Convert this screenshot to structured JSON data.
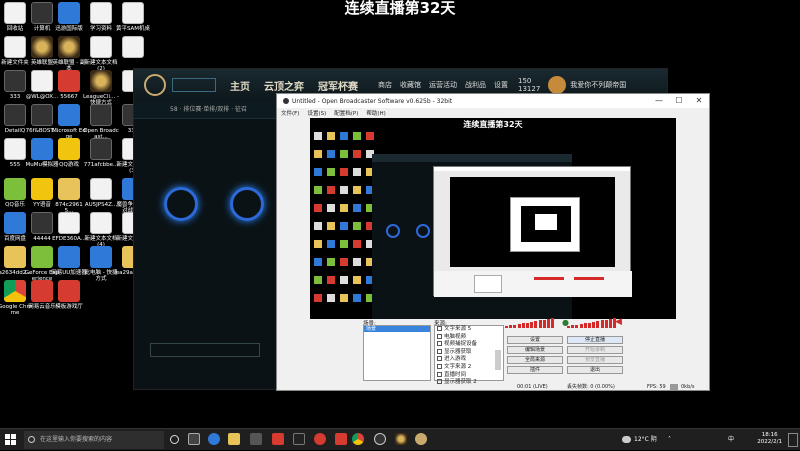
{
  "overlay_title": "连续直播第32天",
  "desktop_icons": [
    {
      "label": "回收站",
      "kind": "g-file"
    },
    {
      "label": "计算机",
      "kind": "g-dark"
    },
    {
      "label": "迅游国际版",
      "kind": "g-blue"
    },
    {
      "label": "学习资料",
      "kind": "g-file"
    },
    {
      "label": "黄平SAM机桌",
      "kind": "g-file"
    },
    {
      "label": "新建文件夹",
      "kind": "g-file"
    },
    {
      "label": "英雄联盟",
      "kind": "g-game"
    },
    {
      "label": "英雄联盟 - 副本",
      "kind": "g-game"
    },
    {
      "label": "新建文本文档 (2)",
      "kind": "g-file"
    },
    {
      "label": "",
      "kind": "g-file"
    },
    {
      "label": "333",
      "kind": "g-dark"
    },
    {
      "label": "@WL@OX...",
      "kind": "g-file"
    },
    {
      "label": "55667",
      "kind": "g-red"
    },
    {
      "label": "LeagueCli... - 快捷方式",
      "kind": "g-game"
    },
    {
      "label": "",
      "kind": "g-file"
    },
    {
      "label": "DetailQ",
      "kind": "g-dark"
    },
    {
      "label": "76f&BOST...",
      "kind": "g-dark"
    },
    {
      "label": "Microsoft Edge",
      "kind": "g-blue"
    },
    {
      "label": "Open Broadcast...",
      "kind": "g-dark"
    },
    {
      "label": "333",
      "kind": "g-dark"
    },
    {
      "label": "555",
      "kind": "g-file"
    },
    {
      "label": "MuMu模拟器",
      "kind": "g-blue"
    },
    {
      "label": "QQ游戏",
      "kind": "g-yellow"
    },
    {
      "label": "771afcbbe...",
      "kind": "g-dark"
    },
    {
      "label": "新建文本文档 (3)",
      "kind": "g-file"
    },
    {
      "label": "QQ音乐",
      "kind": "g-green"
    },
    {
      "label": "YY语音",
      "kind": "g-yellow"
    },
    {
      "label": "874c29615...",
      "kind": "g-folder"
    },
    {
      "label": "AU5JPS4Z...",
      "kind": "g-file"
    },
    {
      "label": "魔兽争霸官方对战平台",
      "kind": "g-blue"
    },
    {
      "label": "百度网盘",
      "kind": "g-blue"
    },
    {
      "label": "44444",
      "kind": "g-dark"
    },
    {
      "label": "EFDE360A...",
      "kind": "g-file"
    },
    {
      "label": "新建文本文档 (4)",
      "kind": "g-file"
    },
    {
      "label": "新建文本文档",
      "kind": "g-file"
    },
    {
      "label": "a2634dd2...",
      "kind": "g-folder"
    },
    {
      "label": "GeForce Experience",
      "kind": "g-green"
    },
    {
      "label": "网易UU加速器",
      "kind": "g-blue"
    },
    {
      "label": "此电脑 - 快捷方式",
      "kind": "g-blue"
    },
    {
      "label": "ea29aefde...",
      "kind": "g-folder"
    },
    {
      "label": "Google Chrome",
      "kind": "g-chrome"
    },
    {
      "label": "网易云音乐",
      "kind": "g-red"
    },
    {
      "label": "模板游戏厅",
      "kind": "g-red"
    }
  ],
  "lol": {
    "nav": [
      "主页",
      "云顶之弈",
      "冠军杯赛"
    ],
    "right_labels": [
      "商店",
      "收藏馆",
      "运营活动",
      "战利品",
      "设置"
    ],
    "currency_be": "150",
    "currency_rp": "13127",
    "summoner": "我爱你不列颠帝国",
    "sub_text": "58 · 排位赛·单排/双排 · 征召"
  },
  "obs": {
    "title": "Untitled - Open Broadcaster Software v0.625b - 32bit",
    "menu": [
      "文件(F)",
      "设置(S)",
      "配置档(P)",
      "帮助(H)"
    ],
    "preview_title": "连续直播第32天",
    "scenes_header": "场景:",
    "scene_selected": "场景",
    "sources_header": "来源:",
    "sources": [
      "文字来源 5",
      "电脑视频",
      "视频捕捉设备",
      "显示器获取",
      "进入游戏",
      "文字来源 2",
      "直播时间",
      "显示器获取 2"
    ],
    "buttons_left": [
      "设置",
      "编辑场景",
      "全局来源",
      "插件"
    ],
    "buttons_right": [
      "停止直播",
      "开始录制",
      "预览直播",
      "退出"
    ],
    "status_time": "00:01 (LIVE)",
    "status_dropped": "丢失帧数: 0 (0.00%)",
    "status_fps": "FPS: 59",
    "status_rate": "0kb/s"
  },
  "taskbar": {
    "search_placeholder": "在这里输入你要搜索的内容",
    "weather": "12°C 阴",
    "ime": "中",
    "time": "18:16",
    "date": "2022/2/1"
  }
}
